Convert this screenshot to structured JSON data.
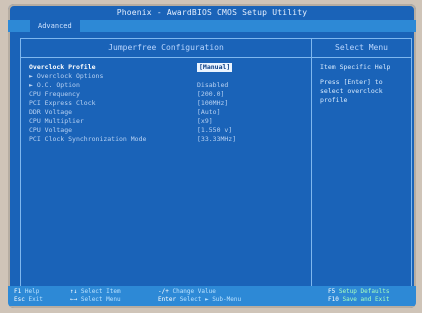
{
  "window": {
    "title": "Phoenix - AwardBIOS CMOS Setup Utility",
    "tab": "Advanced"
  },
  "left_panel": {
    "header": "Jumperfree Configuration",
    "rows": [
      {
        "label": "Overclock Profile",
        "value": "[Manual]",
        "selected": true
      },
      {
        "label": "► Overclock Options",
        "value": ""
      },
      {
        "label": "► O.C. Option",
        "value": "Disabled"
      },
      {
        "label": "CPU Frequency",
        "value": "[200.0]"
      },
      {
        "label": "PCI Express Clock",
        "value": "[100MHz]"
      },
      {
        "label": "DDR Voltage",
        "value": "[Auto]"
      },
      {
        "label": "CPU Multiplier",
        "value": "[x9]"
      },
      {
        "label": "CPU Voltage",
        "value": "[1.550 v]"
      },
      {
        "label": "PCI Clock Synchronization Mode",
        "value": "[33.33MHz]"
      }
    ]
  },
  "right_panel": {
    "header": "Select Menu",
    "help": [
      "Item Specific Help",
      "Press [Enter] to select overclock profile"
    ]
  },
  "footer": {
    "items": [
      {
        "key": "F1",
        "text": "Help"
      },
      {
        "key": "Esc",
        "text": "Exit"
      },
      {
        "key": "↑↓",
        "text": "Select Item"
      },
      {
        "key": "←→",
        "text": "Select Menu"
      },
      {
        "key": "-/+",
        "text": "Change Value"
      },
      {
        "key": "Enter",
        "text": "Select ► Sub-Menu"
      },
      {
        "key": "F5",
        "text": "Setup Defaults"
      },
      {
        "key": "F10",
        "text": "Save and Exit"
      }
    ]
  }
}
